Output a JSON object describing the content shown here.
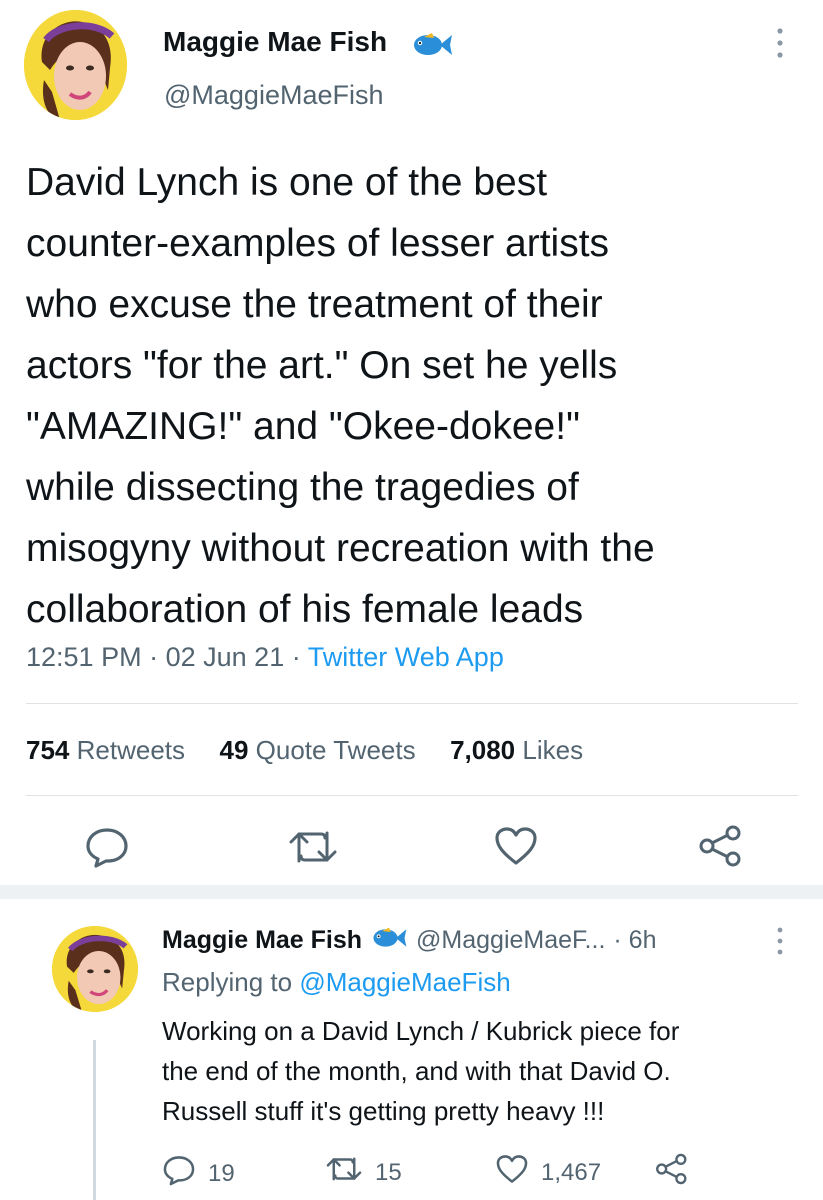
{
  "tweet": {
    "author_name": "Maggie Mae Fish",
    "author_handle": "@MaggieMaeFish",
    "lines": [
      "David Lynch is one of the best",
      "counter-examples of lesser artists",
      "who excuse the treatment of their",
      "actors \"for the art.\" On set he yells",
      "\"AMAZING!\" and \"Okee-dokee!\"",
      "while dissecting the tragedies of",
      "misogyny without recreation with the",
      "collaboration of his female leads"
    ],
    "time": "12:51 PM",
    "sep": "·",
    "date": "02 Jun 21",
    "source": "Twitter Web App",
    "retweets_count": "754",
    "retweets_label": "Retweets",
    "quotes_count": "49",
    "quotes_label": "Quote Tweets",
    "likes_count": "7,080",
    "likes_label": "Likes"
  },
  "reply": {
    "author_name": "Maggie Mae Fish",
    "author_handle": "@MaggieMaeF...",
    "age": "· 6h",
    "replying_prefix": "Replying to",
    "replying_to": "@MaggieMaeFish",
    "lines": [
      "Working on a David Lynch / Kubrick piece for",
      "the end of the month, and with that David O.",
      "Russell stuff it's getting pretty heavy !!!"
    ],
    "reply_count": "19",
    "retweet_count": "15",
    "like_count": "1,467"
  },
  "icons": {
    "fish": "fish-emoji-icon",
    "more": "more-vertical-icon",
    "reply": "reply-icon",
    "retweet": "retweet-icon",
    "like": "heart-icon",
    "share": "share-icon"
  },
  "colors": {
    "link": "#1d9bf0",
    "secondary_text": "#536471",
    "avatar_bg": "#f5d93a",
    "fish": "#2a8fd8"
  }
}
